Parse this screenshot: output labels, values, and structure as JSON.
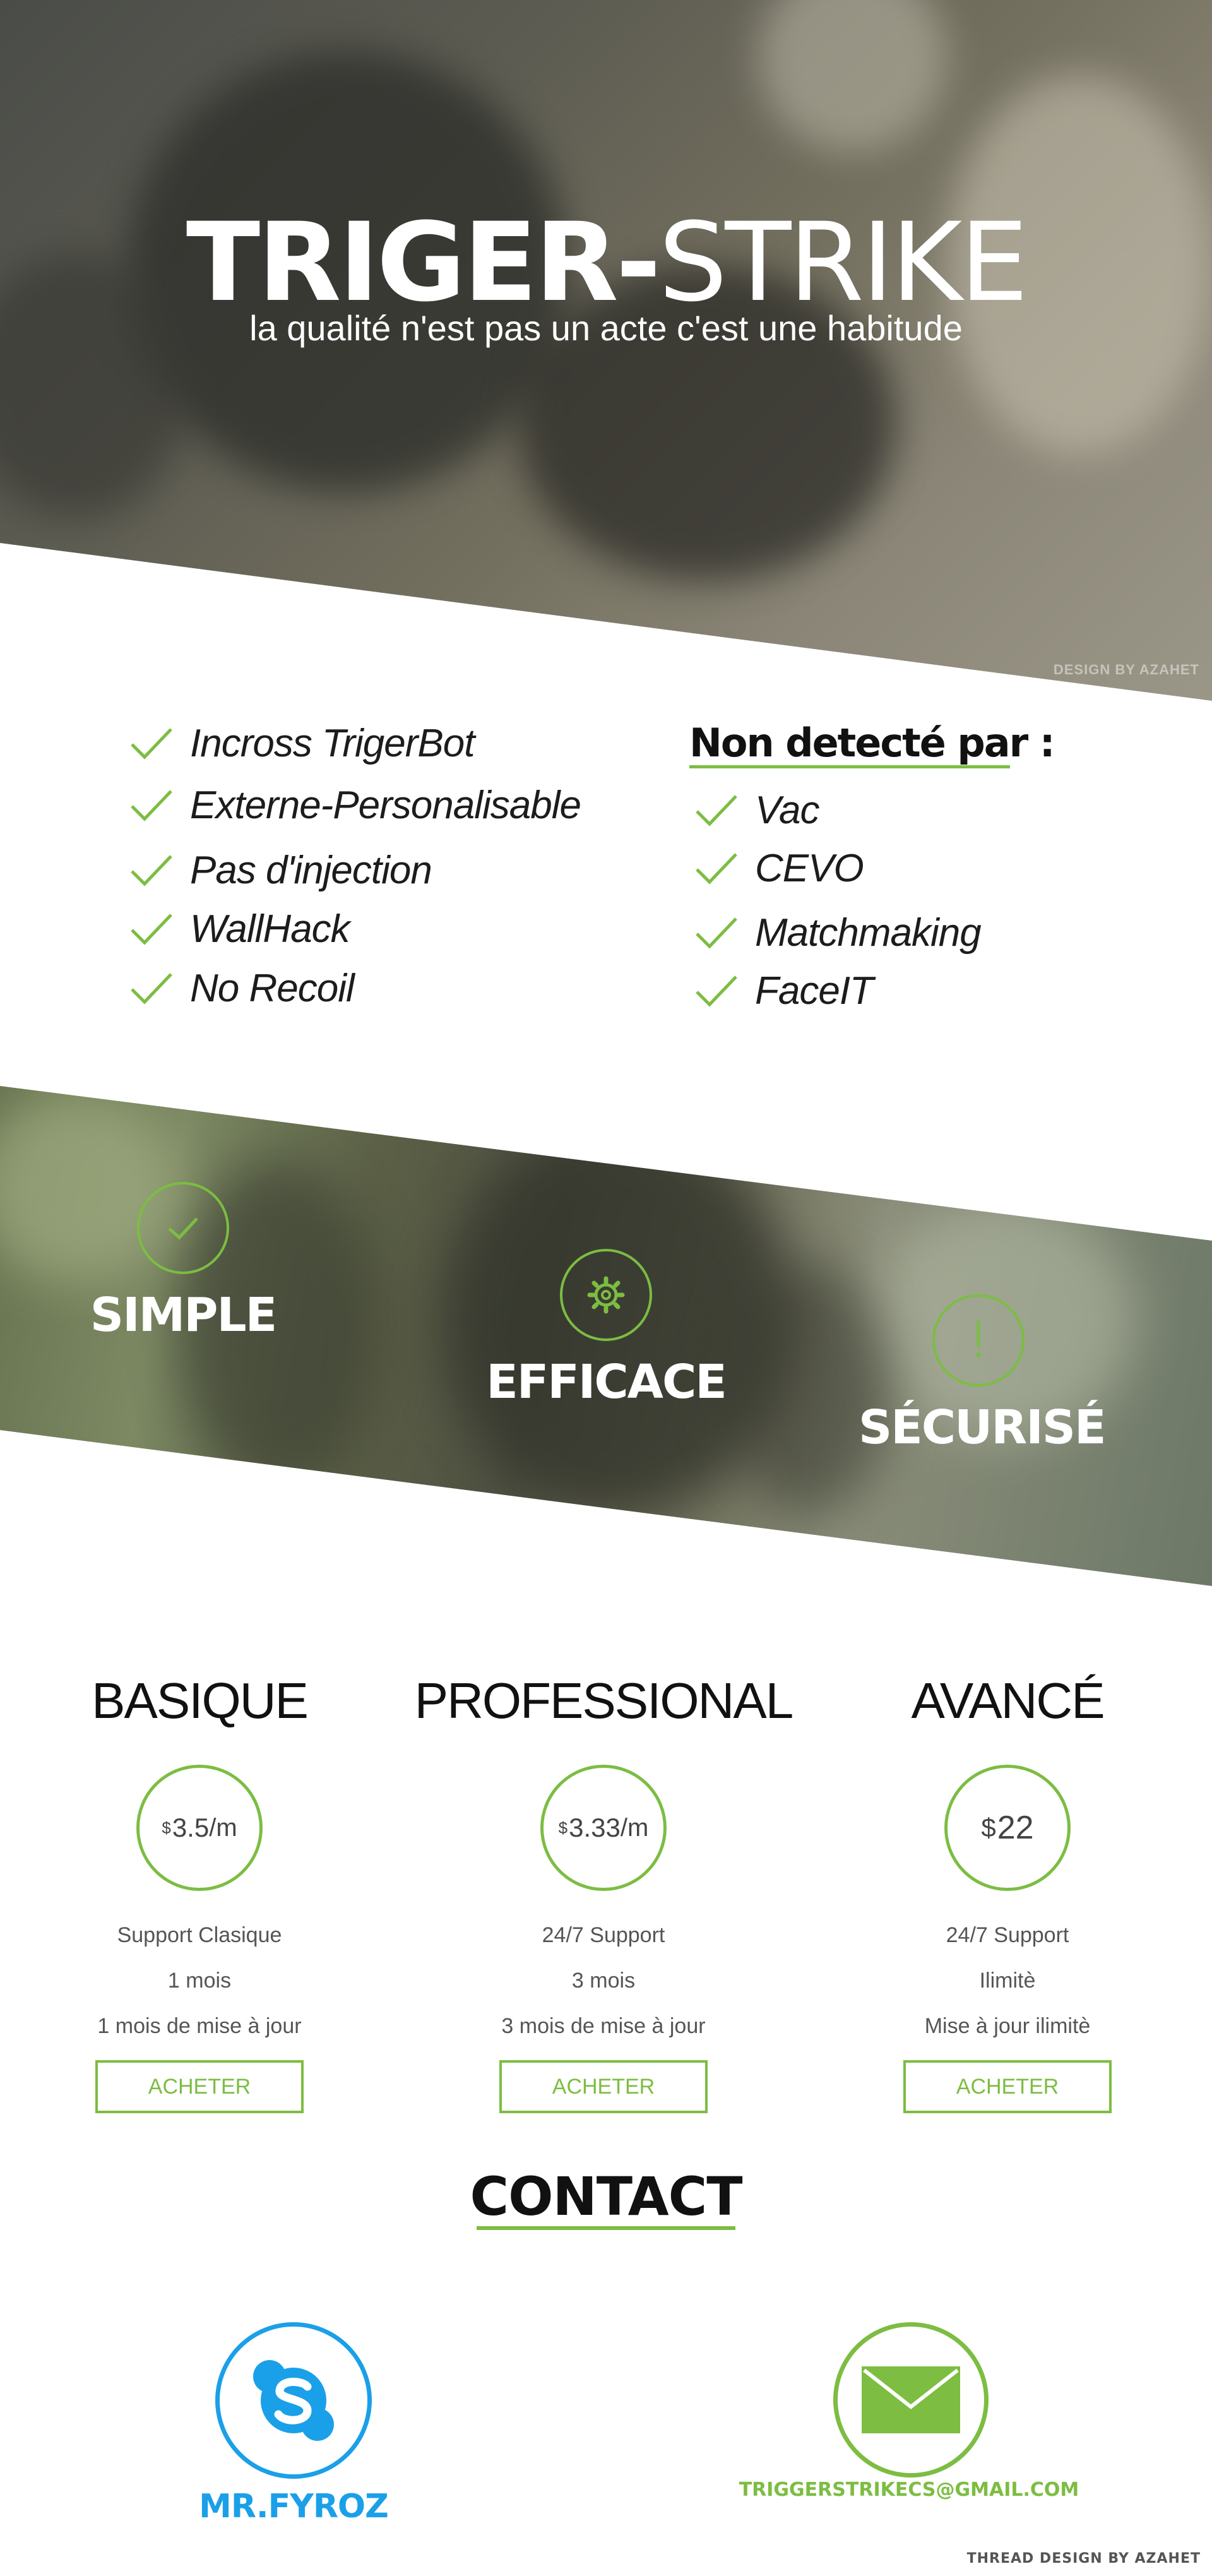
{
  "hero": {
    "title_bold": "TRIGER-",
    "title_thin": "STRIKE",
    "subtitle": "la qualité n'est pas un acte c'est une habitude",
    "watermark": "DESIGN BY AZAHET"
  },
  "features": {
    "items": [
      "Incross TrigerBot",
      "Externe-Personalisable",
      "Pas d'injection",
      "WallHack",
      "No Recoil"
    ],
    "undetected_title": "Non detecté par :",
    "undetected_items": [
      "Vac",
      "CEVO",
      "Matchmaking",
      "FaceIT"
    ]
  },
  "band": {
    "items": [
      {
        "label": "SIMPLE",
        "icon": "check-icon"
      },
      {
        "label": "EFFICACE",
        "icon": "gear-icon"
      },
      {
        "label": "SÉCURISÉ",
        "icon": "exclamation-icon"
      }
    ]
  },
  "pricing": {
    "plans": [
      {
        "name": "BASIQUE",
        "currency": "$",
        "amount": "3.5",
        "period": "/m",
        "lines": [
          "Support Clasique",
          "1 mois",
          "1 mois de mise à jour"
        ],
        "button": "ACHETER"
      },
      {
        "name": "PROFESSIONAL",
        "currency": "$",
        "amount": "3.33",
        "period": "/m",
        "lines": [
          "24/7 Support",
          "3 mois",
          "3 mois de mise à jour"
        ],
        "button": "ACHETER"
      },
      {
        "name": "AVANCÉ",
        "currency": "$",
        "amount": "22",
        "period": "",
        "lines": [
          "24/7 Support",
          "Ilimitè",
          "Mise à jour ilimitè"
        ],
        "button": "ACHETER"
      }
    ]
  },
  "contact": {
    "title": "CONTACT",
    "skype_name": "MR.FYROZ",
    "email": "TRIGGERSTRIKECS@GMAIL.COM"
  },
  "footer": {
    "credit": "THREAD DESIGN BY AZAHET"
  },
  "colors": {
    "accent": "#7cbd42",
    "skype_blue": "#1aa0e8",
    "text_dark": "#111111",
    "text_gray": "#555555"
  }
}
